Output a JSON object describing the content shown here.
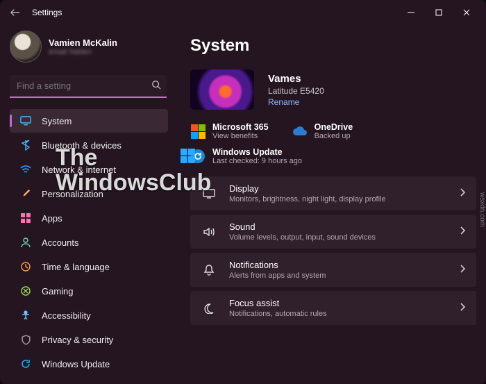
{
  "window": {
    "title": "Settings"
  },
  "profile": {
    "name": "Vamien McKalin",
    "sub": "email hidden"
  },
  "search": {
    "placeholder": "Find a setting"
  },
  "sidebar": {
    "items": [
      {
        "label": "System",
        "active": true
      },
      {
        "label": "Bluetooth & devices"
      },
      {
        "label": "Network & internet"
      },
      {
        "label": "Personalization"
      },
      {
        "label": "Apps"
      },
      {
        "label": "Accounts"
      },
      {
        "label": "Time & language"
      },
      {
        "label": "Gaming"
      },
      {
        "label": "Accessibility"
      },
      {
        "label": "Privacy & security"
      },
      {
        "label": "Windows Update"
      }
    ]
  },
  "main": {
    "heading": "System",
    "device": {
      "name": "Vames",
      "model": "Latitude E5420",
      "rename": "Rename"
    },
    "status": {
      "m365": {
        "title": "Microsoft 365",
        "sub": "View benefits"
      },
      "onedrive": {
        "title": "OneDrive",
        "sub": "Backed up"
      },
      "update": {
        "title": "Windows Update",
        "sub": "Last checked: 9 hours ago"
      }
    },
    "cards": [
      {
        "title": "Display",
        "sub": "Monitors, brightness, night light, display profile"
      },
      {
        "title": "Sound",
        "sub": "Volume levels, output, input, sound devices"
      },
      {
        "title": "Notifications",
        "sub": "Alerts from apps and system"
      },
      {
        "title": "Focus assist",
        "sub": "Notifications, automatic rules"
      }
    ]
  },
  "watermark": {
    "line1": "The",
    "line2": "WindowsClub"
  },
  "attrib": "wsxdn.com"
}
